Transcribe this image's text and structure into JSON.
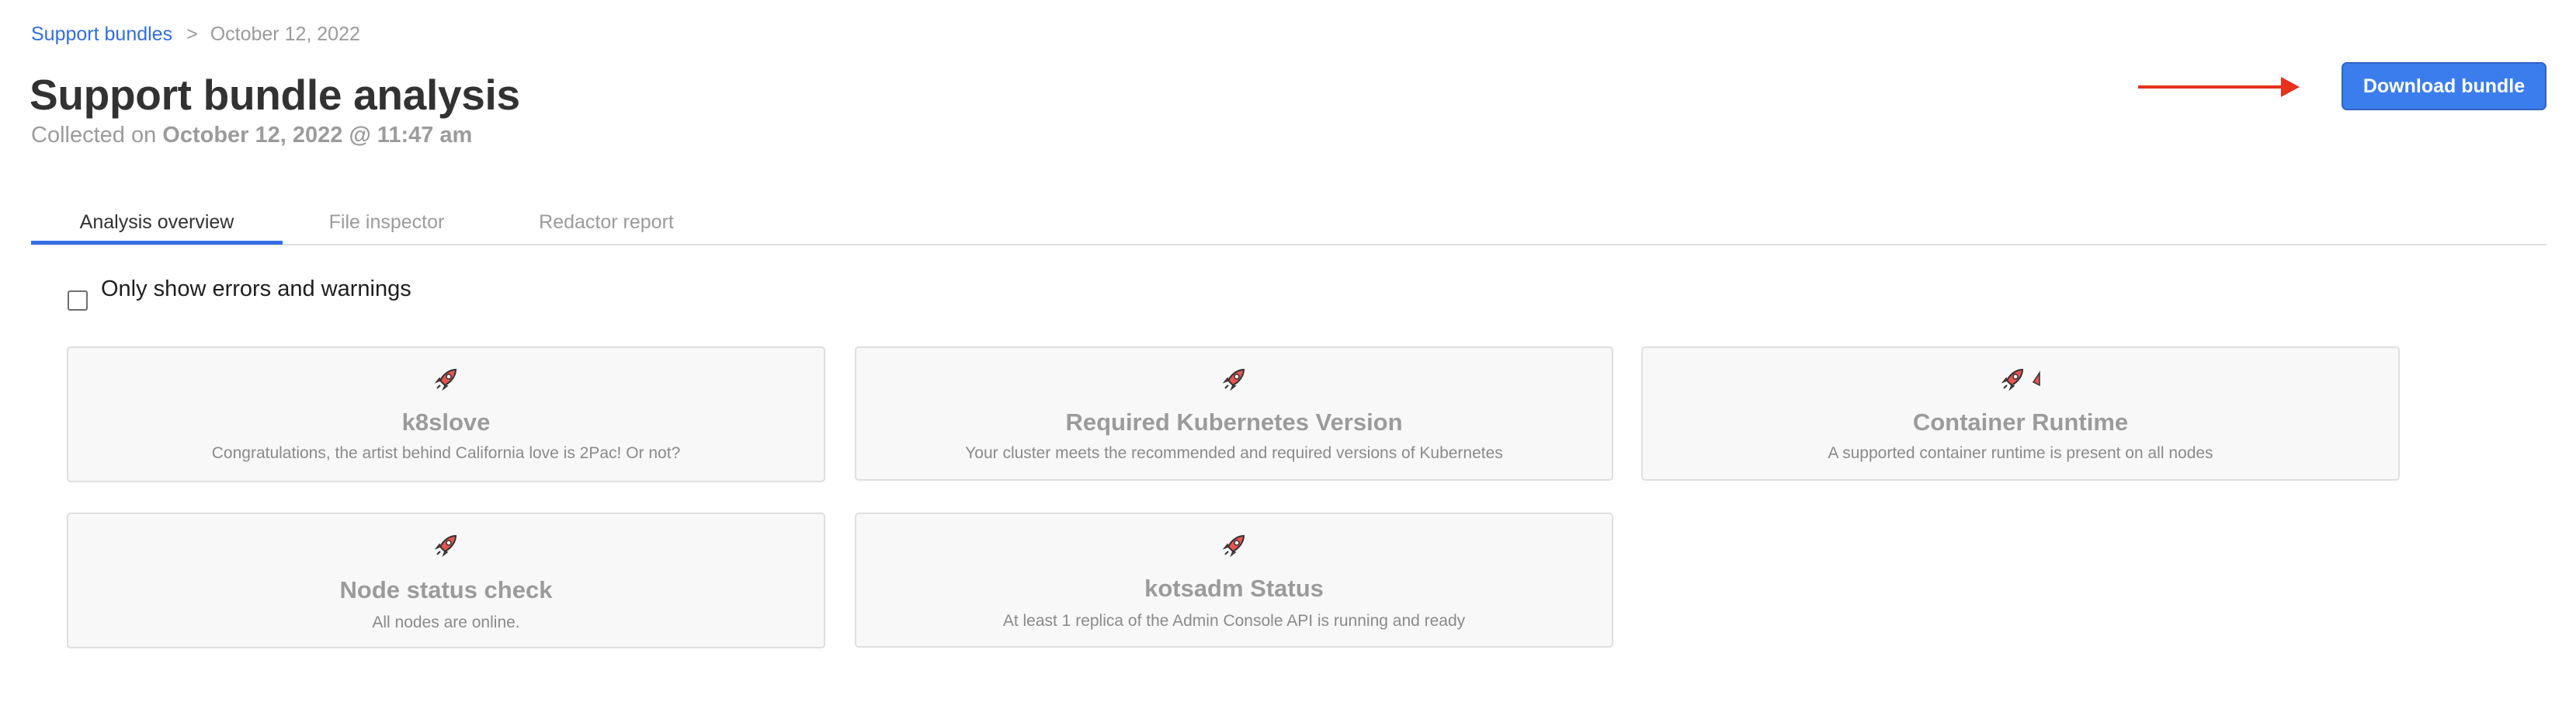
{
  "breadcrumb": {
    "parent_label": "Support bundles",
    "separator": ">",
    "current_label": "October 12, 2022"
  },
  "header": {
    "title": "Support bundle analysis",
    "collected_prefix": "Collected on",
    "collected_value": "October 12, 2022 @ 11:47 am",
    "download_label": "Download bundle"
  },
  "colors": {
    "accent": "#326de6",
    "button_bg": "#3b7ded",
    "annotation_arrow": "#e8301c",
    "card_bg": "#f8f8f8",
    "muted_text": "#9b9b9b"
  },
  "tabs": [
    {
      "label": "Analysis overview",
      "active": true
    },
    {
      "label": "File inspector",
      "active": false
    },
    {
      "label": "Redactor report",
      "active": false
    }
  ],
  "filter": {
    "label": "Only show errors and warnings",
    "checked": false
  },
  "cards": [
    {
      "icon": "rocket-icon",
      "title": "k8slove",
      "description": "Congratulations, the artist behind California love is 2Pac! Or not?"
    },
    {
      "icon": "rocket-icon",
      "title": "Required Kubernetes Version",
      "description": "Your cluster meets the recommended and required versions of Kubernetes"
    },
    {
      "icon": "rocket-icon",
      "title": "Container Runtime",
      "description": "A supported container runtime is present on all nodes"
    },
    {
      "icon": "rocket-icon",
      "title": "Node status check",
      "description": "All nodes are online."
    },
    {
      "icon": "rocket-icon",
      "title": "kotsadm Status",
      "description": "At least 1 replica of the Admin Console API is running and ready"
    }
  ]
}
